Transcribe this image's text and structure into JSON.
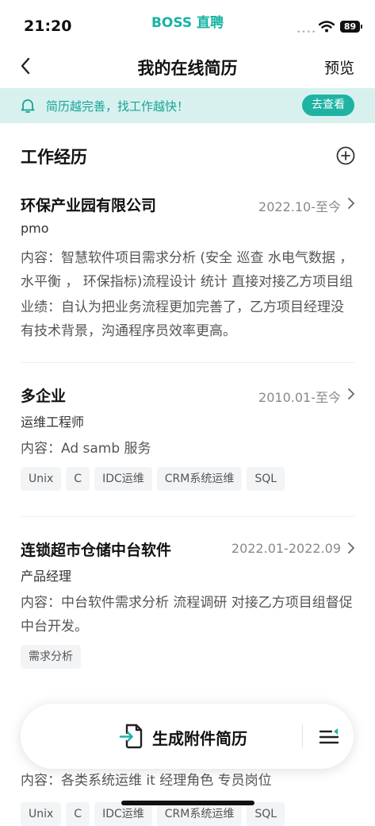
{
  "status_bar": {
    "time": "21:20",
    "brand": "BOSS 直聘",
    "battery": "89",
    "signal_dots": "••••"
  },
  "nav": {
    "title": "我的在线简历",
    "preview": "预览"
  },
  "tip": {
    "text": "简历越完善，找工作越快！",
    "button": "去查看"
  },
  "section": {
    "title": "工作经历"
  },
  "experiences": [
    {
      "company": "环保产业园有限公司",
      "date": "2022.10-至今",
      "role": "pmo",
      "content": "内容：智慧软件项目需求分析 (安全 巡查 水电气数据 ， 水平衡 ， 环保指标)流程设计 统计 直接对接乙方项目组",
      "achievement": "业绩：自认为把业务流程更加完善了，乙方项目经理没有技术背景，沟通程序员效率更高。"
    },
    {
      "company": "多企业",
      "date": "2010.01-至今",
      "role": "运维工程师",
      "content": "内容：Ad samb  服务",
      "tags": [
        "Unix",
        "C",
        "IDC运维",
        "CRM系统运维",
        "SQL"
      ]
    },
    {
      "company": "连锁超市仓储中台软件",
      "date": "2022.01-2022.09",
      "role": "产品经理",
      "content": "内容：中台软件需求分析 流程调研 对接乙方项目组督促中台开发。",
      "tags": [
        "需求分析"
      ]
    },
    {
      "content": "内容：各类系统运维 it  经理角色 专员岗位",
      "tags": [
        "Unix",
        "C",
        "IDC运维",
        "CRM系统运维",
        "SQL"
      ]
    }
  ],
  "bottom_bar": {
    "generate_label": "生成附件简历"
  },
  "colors": {
    "accent": "#1fb3a4",
    "banner_bg": "#d8f1ef",
    "tag_bg": "#f3f4f6"
  }
}
